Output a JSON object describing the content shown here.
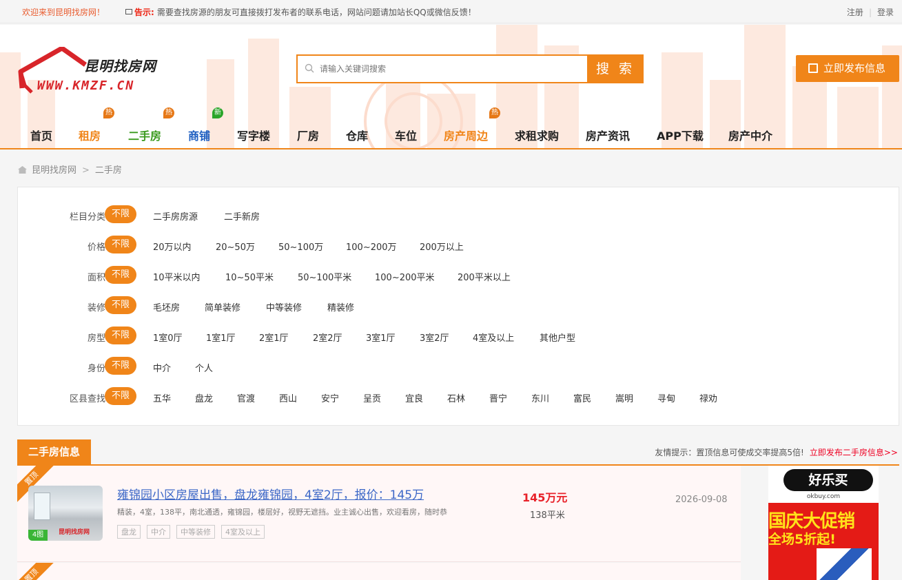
{
  "topbar": {
    "welcome": "欢迎来到昆明找房网！",
    "notice_tag": "告示:",
    "notice_text": "需要查找房源的朋友可直接拨打发布者的联系电话，网站问题请加站长QQ或微信反馈！",
    "register": "注册",
    "login": "登录"
  },
  "header": {
    "site_name": "昆明找房网",
    "site_url": "WWW.KMZF.CN",
    "search_placeholder": "请输入关键词搜索",
    "search_button": "搜 索",
    "publish_button": "立即发布信息"
  },
  "nav": [
    {
      "label": "首页",
      "color": "#222222"
    },
    {
      "label": "租房",
      "color": "#f08519",
      "badge": "热",
      "badge_color": "#e67817"
    },
    {
      "label": "二手房",
      "color": "#3a9a1e",
      "badge": "热",
      "badge_color": "#e67817"
    },
    {
      "label": "商铺",
      "color": "#1f5fc1",
      "badge": "新",
      "badge_color": "#2aa52a"
    },
    {
      "label": "写字楼",
      "color": "#222222"
    },
    {
      "label": "厂房",
      "color": "#222222"
    },
    {
      "label": "仓库",
      "color": "#222222"
    },
    {
      "label": "车位",
      "color": "#222222"
    },
    {
      "label": "房产周边",
      "color": "#f08519",
      "badge": "热",
      "badge_color": "#e67817"
    },
    {
      "label": "求租求购",
      "color": "#222222"
    },
    {
      "label": "房产资讯",
      "color": "#222222"
    },
    {
      "label": "APP下载",
      "color": "#222222"
    },
    {
      "label": "房产中介",
      "color": "#222222"
    }
  ],
  "breadcrumb": {
    "home": "昆明找房网",
    "sep": ">",
    "current": "二手房"
  },
  "filters": [
    {
      "label": "栏目分类",
      "options": [
        "不限",
        "二手房房源",
        "二手新房"
      ]
    },
    {
      "label": "价格",
      "options": [
        "不限",
        "20万以内",
        "20~50万",
        "50~100万",
        "100~200万",
        "200万以上"
      ]
    },
    {
      "label": "面积",
      "options": [
        "不限",
        "10平米以内",
        "10~50平米",
        "50~100平米",
        "100~200平米",
        "200平米以上"
      ]
    },
    {
      "label": "装修",
      "options": [
        "不限",
        "毛坯房",
        "简单装修",
        "中等装修",
        "精装修"
      ]
    },
    {
      "label": "房型",
      "options": [
        "不限",
        "1室0厅",
        "1室1厅",
        "2室1厅",
        "2室2厅",
        "3室1厅",
        "3室2厅",
        "4室及以上",
        "其他户型"
      ]
    },
    {
      "label": "身份",
      "options": [
        "不限",
        "中介",
        "个人"
      ]
    },
    {
      "label": "区县查找",
      "options": [
        "不限",
        "五华",
        "盘龙",
        "官渡",
        "西山",
        "安宁",
        "呈贡",
        "宜良",
        "石林",
        "晋宁",
        "东川",
        "富民",
        "嵩明",
        "寻甸",
        "禄劝"
      ]
    }
  ],
  "section": {
    "title": "二手房信息",
    "tip": "友情提示：置顶信息可使成交率提高5倍!",
    "tip_link": "立即发布二手房信息>>"
  },
  "listings": [
    {
      "ribbon": "置顶",
      "photo_count": "4图",
      "watermark": "昆明找房网",
      "title": "雍锦园小区房屋出售，盘龙雍锦园，4室2厅，报价：145万",
      "desc": "精装，4室，138平，南北通透，雍锦园，楼层好，视野无遮挡。业主诚心出售，欢迎看房，随时恭",
      "tags": [
        "盘龙",
        "中介",
        "中等装修",
        "4室及以上"
      ],
      "price": "145万元",
      "area": "138平米",
      "date": "2026-09-08"
    },
    {
      "ribbon": "置顶"
    }
  ],
  "ad": {
    "brand": "好乐买",
    "domain": "okbuy.com",
    "headline": "国庆大促销",
    "sub": "全场5折起!"
  },
  "colors": {
    "accent": "#f08519",
    "price": "#e8222a",
    "link": "#3b67c7"
  }
}
